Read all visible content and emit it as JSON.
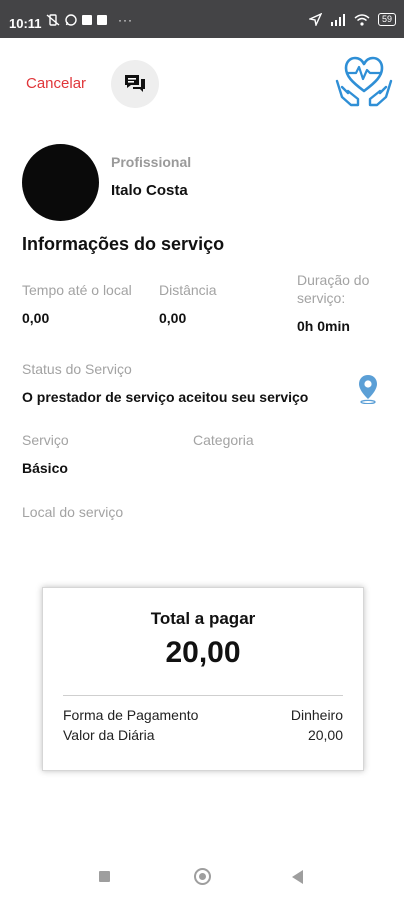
{
  "status_bar": {
    "time": "10:11",
    "battery": "59"
  },
  "header": {
    "cancel_label": "Cancelar"
  },
  "professional": {
    "label": "Profissional",
    "name": "Italo Costa"
  },
  "service_info": {
    "title": "Informações do serviço",
    "time_label": "Tempo até o local",
    "time_value": "0,00",
    "distance_label": "Distância",
    "distance_value": "0,00",
    "duration_label_line1": "Duração do",
    "duration_label_line2": "serviço:",
    "duration_value": "0h 0min",
    "status_label": "Status do Serviço",
    "status_value": "O prestador de serviço aceitou seu serviço",
    "service_label": "Serviço",
    "service_value": "Básico",
    "category_label": "Categoria",
    "location_label": "Local do serviço"
  },
  "payment_card": {
    "total_label": "Total a pagar",
    "total_value": "20,00",
    "method_label": "Forma de Pagamento",
    "method_value": "Dinheiro",
    "daily_label": "Valor da Diária",
    "daily_value": "20,00"
  },
  "colors": {
    "cancel": "#e0363a",
    "brand_blue": "#2f8fd6",
    "pin_blue": "#5b9fd6",
    "status_bar": "#444446"
  },
  "icons": {
    "chat": "chat-bubbles-icon",
    "brand": "heart-in-hands-icon",
    "location": "location-pin-icon"
  }
}
